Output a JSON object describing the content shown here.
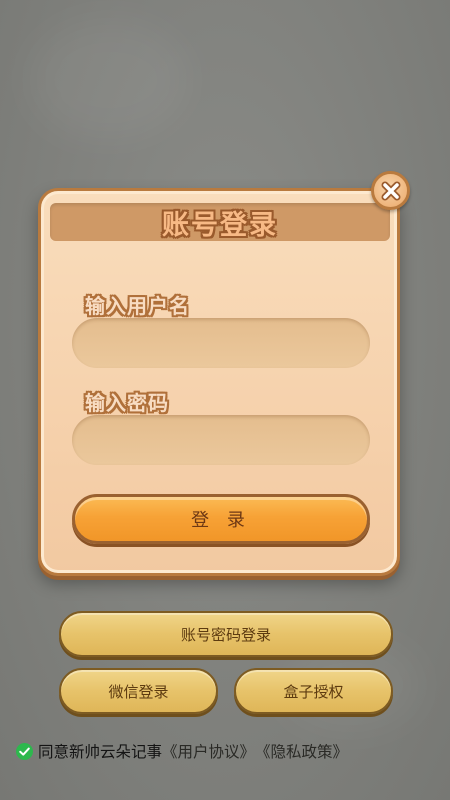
{
  "dialog": {
    "title": "账号登录",
    "username_label": "输入用户名",
    "username_value": "",
    "password_label": "输入密码",
    "password_value": "",
    "login_label": "登 录",
    "close_icon": "close-icon"
  },
  "actions": {
    "account_login_label": "账号密码登录",
    "wechat_login_label": "微信登录",
    "box_auth_label": "盒子授权"
  },
  "agreement": {
    "checked": true,
    "text": "同意新帅云朵记事",
    "user_agreement": "《用户协议》",
    "privacy_policy": "《隐私政策》"
  },
  "colors": {
    "dialog_bg": "#f6d2ad",
    "dialog_border": "#b97a3e",
    "header_bg": "#cf9966",
    "primary_button": "#f7a236",
    "secondary_button": "#e7c36a",
    "check": "#2db84d",
    "page_bg": "#80817d"
  }
}
